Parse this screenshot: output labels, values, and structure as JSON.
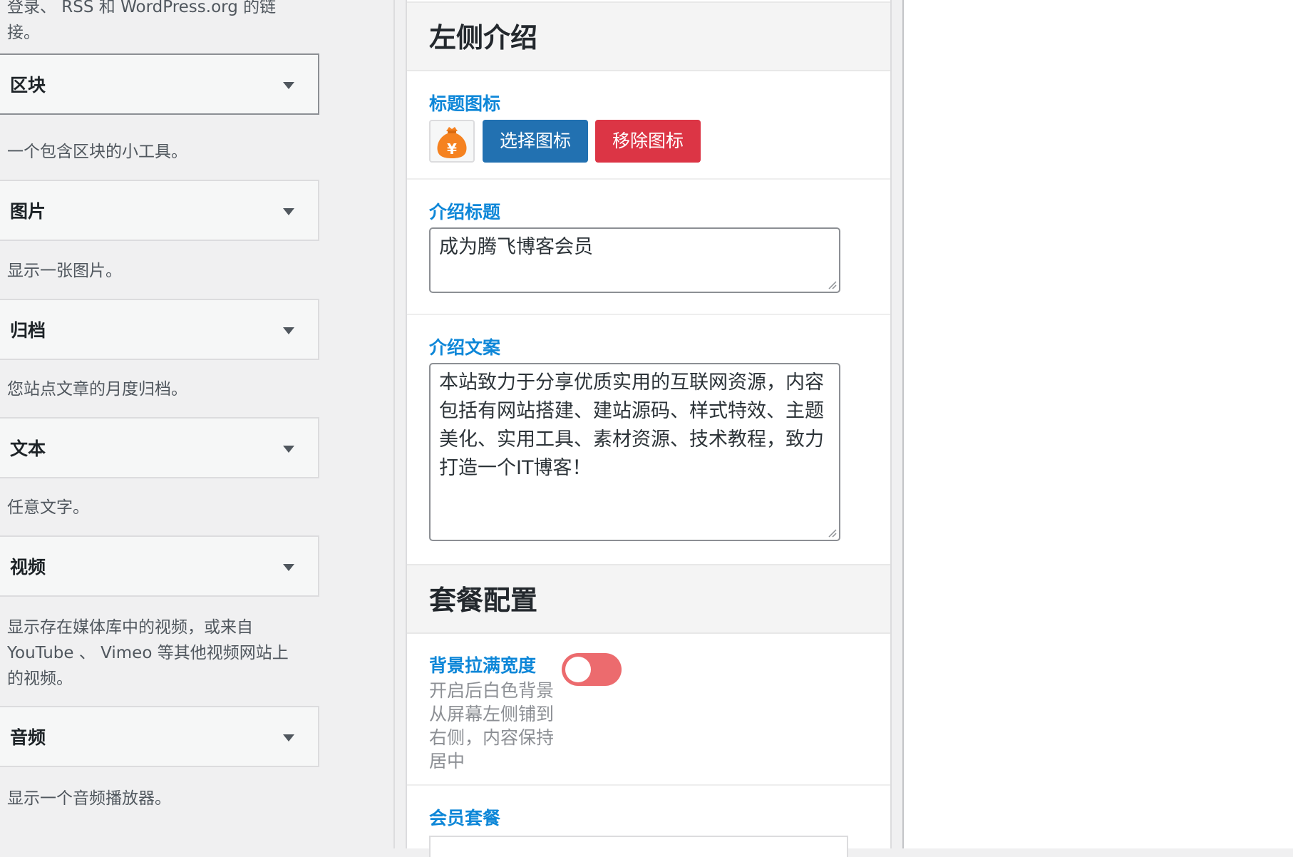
{
  "left": {
    "top_desc": "登录、 RSS 和 WordPress.org 的链接。",
    "widgets": [
      {
        "title": "区块",
        "desc": "一个包含区块的小工具。"
      },
      {
        "title": "图片",
        "desc": "显示一张图片。"
      },
      {
        "title": "归档",
        "desc": "您站点文章的月度归档。"
      },
      {
        "title": "文本",
        "desc": "任意文字。"
      },
      {
        "title": "视频",
        "desc": "显示存在媒体库中的视频，或来自 YouTube 、 Vimeo 等其他视频网站上的视频。"
      },
      {
        "title": "音频",
        "desc": "显示一个音频播放器。"
      }
    ]
  },
  "panel": {
    "section_intro": "左侧介绍",
    "icon_label": "标题图标",
    "select_icon_button": "选择图标",
    "remove_icon_button": "移除图标",
    "intro_title_label": "介绍标题",
    "intro_title_value": "成为腾飞博客会员",
    "intro_copy_label": "介绍文案",
    "intro_copy_value": "本站致力于分享优质实用的互联网资源，内容包括有网站搭建、建站源码、样式特效、主题美化、实用工具、素材资源、技术教程，致力打造一个IT博客！",
    "section_package": "套餐配置",
    "bg_full_width_label": "背景拉满宽度",
    "bg_full_width_help": "开启后白色背景从屏幕左侧铺到右侧，内容保持居中",
    "member_package_label": "会员套餐"
  },
  "colors": {
    "accent_blue": "#2271b1",
    "danger_red": "#dc3545",
    "label_blue": "#0e87d8",
    "toggle_off": "#ec6b6e"
  }
}
